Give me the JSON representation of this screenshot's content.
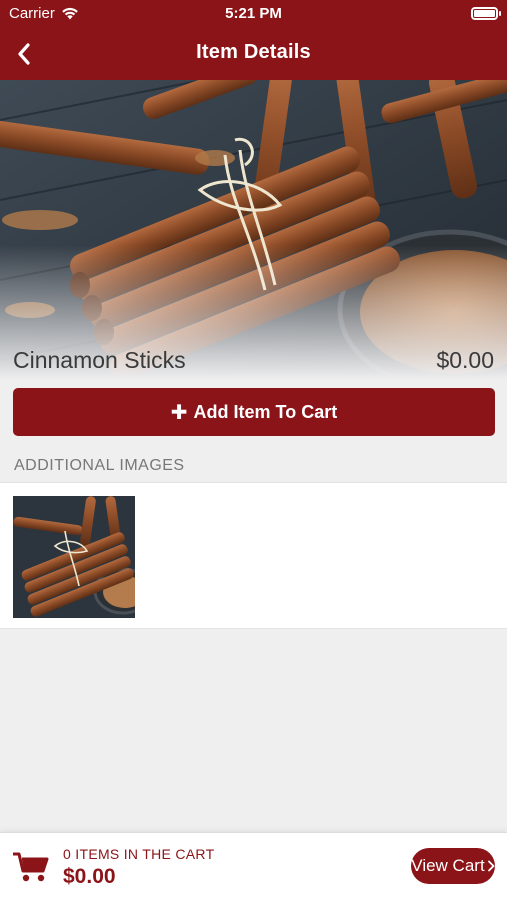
{
  "status_bar": {
    "carrier": "Carrier",
    "time": "5:21 PM"
  },
  "nav": {
    "title": "Item Details",
    "back_icon": "chevron-left-icon"
  },
  "item": {
    "name": "Cinnamon Sticks",
    "price": "$0.00"
  },
  "actions": {
    "add_to_cart_label": "Add Item To Cart",
    "add_icon": "plus-icon"
  },
  "additional_images": {
    "heading": "ADDITIONAL IMAGES",
    "count_thumbnails": 1
  },
  "cart": {
    "items_label": "0 ITEMS IN THE CART",
    "total": "$0.00",
    "view_cart_label": "View Cart",
    "cart_icon": "cart-icon"
  },
  "colors": {
    "brand": "#8b1418",
    "background": "#efeff0",
    "text": "#3a3a3a",
    "muted": "#777777"
  }
}
